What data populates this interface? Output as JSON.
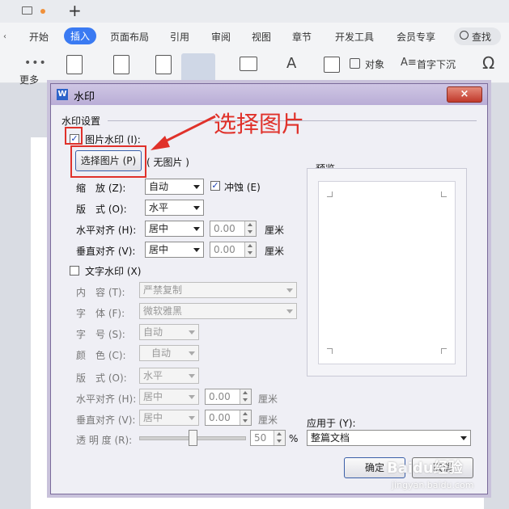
{
  "titlebar": {
    "new_tab_label": "+"
  },
  "ribbon_tabs": [
    "开始",
    "插入",
    "页面布局",
    "引用",
    "审阅",
    "视图",
    "章节",
    "开发工具",
    "会员专享"
  ],
  "ribbon_active": "插入",
  "search_label": "查找",
  "ribbon": {
    "more_label": "更多",
    "object_label": "对象",
    "dropcap_label": "首字下沉"
  },
  "dialog": {
    "title": "水印",
    "close_label": "×",
    "group_title": "水印设置",
    "image_wm": {
      "label": "图片水印 (I):",
      "checked": true,
      "select_button": "选择图片 (P)",
      "no_image": "( 无图片 )",
      "scale_label": "缩　放 (Z):",
      "scale_value": "自动",
      "washout_label": "冲蚀 (E)",
      "washout_checked": true,
      "layout_label": "版　式 (O):",
      "layout_value": "水平",
      "halign_label": "水平对齐 (H):",
      "halign_value": "居中",
      "halign_num": "0.00",
      "valign_label": "垂直对齐 (V):",
      "valign_value": "居中",
      "valign_num": "0.00",
      "unit": "厘米"
    },
    "text_wm": {
      "label": "文字水印 (X)",
      "checked": false,
      "content_label": "内　容 (T):",
      "content_value": "严禁复制",
      "font_label": "字　体 (F):",
      "font_value": "微软雅黑",
      "size_label": "字　号 (S):",
      "size_value": "自动",
      "color_label": "颜　色 (C):",
      "color_value": "自动",
      "layout_label": "版　式 (O):",
      "layout_value": "水平",
      "halign_label": "水平对齐 (H):",
      "halign_value": "居中",
      "halign_num": "0.00",
      "valign_label": "垂直对齐 (V):",
      "valign_value": "居中",
      "valign_num": "0.00",
      "unit": "厘米",
      "transparency_label": "透 明 度 (R):",
      "transparency_value": "50",
      "transparency_unit": "%"
    },
    "preview_label": "预览",
    "apply_label": "应用于 (Y):",
    "apply_value": "整篇文档",
    "ok_label": "确定",
    "cancel_label": "取消"
  },
  "annotation": {
    "callout": "选择图片",
    "color": "#e0312a"
  },
  "watermark": {
    "brand": "Baidu经验",
    "url": "jingyan.baidu.com"
  },
  "colors": {
    "accent": "#3a7af2",
    "dialog_title": "#b9add6"
  }
}
